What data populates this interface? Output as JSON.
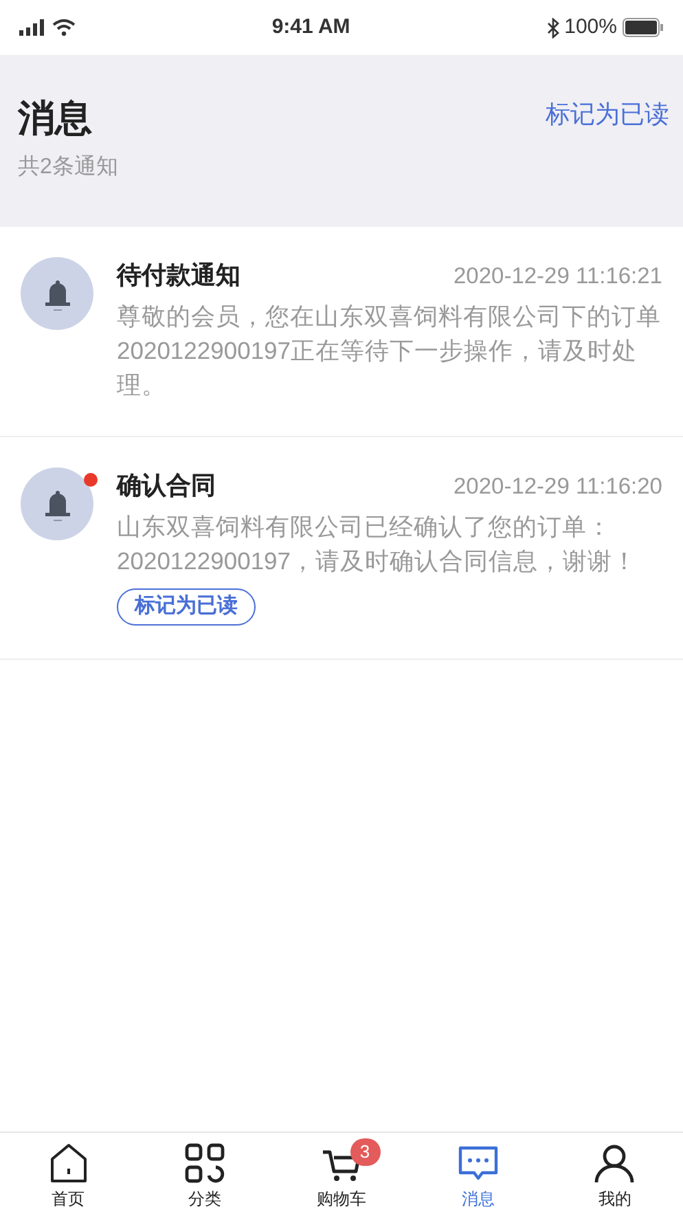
{
  "status_bar": {
    "time": "9:41 AM",
    "battery": "100%"
  },
  "header": {
    "title": "消息",
    "subtitle": "共2条通知",
    "action": "标记为已读"
  },
  "messages": [
    {
      "title": "待付款通知",
      "time": "2020-12-29 11:16:21",
      "body": "尊敬的会员，您在山东双喜饲料有限公司下的订单2020122900197正在等待下一步操作，请及时处理。",
      "unread": false
    },
    {
      "title": "确认合同",
      "time": "2020-12-29 11:16:20",
      "body": "山东双喜饲料有限公司已经确认了您的订单：2020122900197，请及时确认合同信息，谢谢！",
      "unread": true,
      "action": "标记为已读"
    }
  ],
  "tab_bar": [
    {
      "kind": "home",
      "label": "首页",
      "selected": false
    },
    {
      "kind": "category",
      "label": "分类",
      "selected": false
    },
    {
      "kind": "cart",
      "label": "购物车",
      "selected": false,
      "badge": "3"
    },
    {
      "kind": "message",
      "label": "消息",
      "selected": true
    },
    {
      "kind": "user",
      "label": "我的",
      "selected": false
    }
  ]
}
